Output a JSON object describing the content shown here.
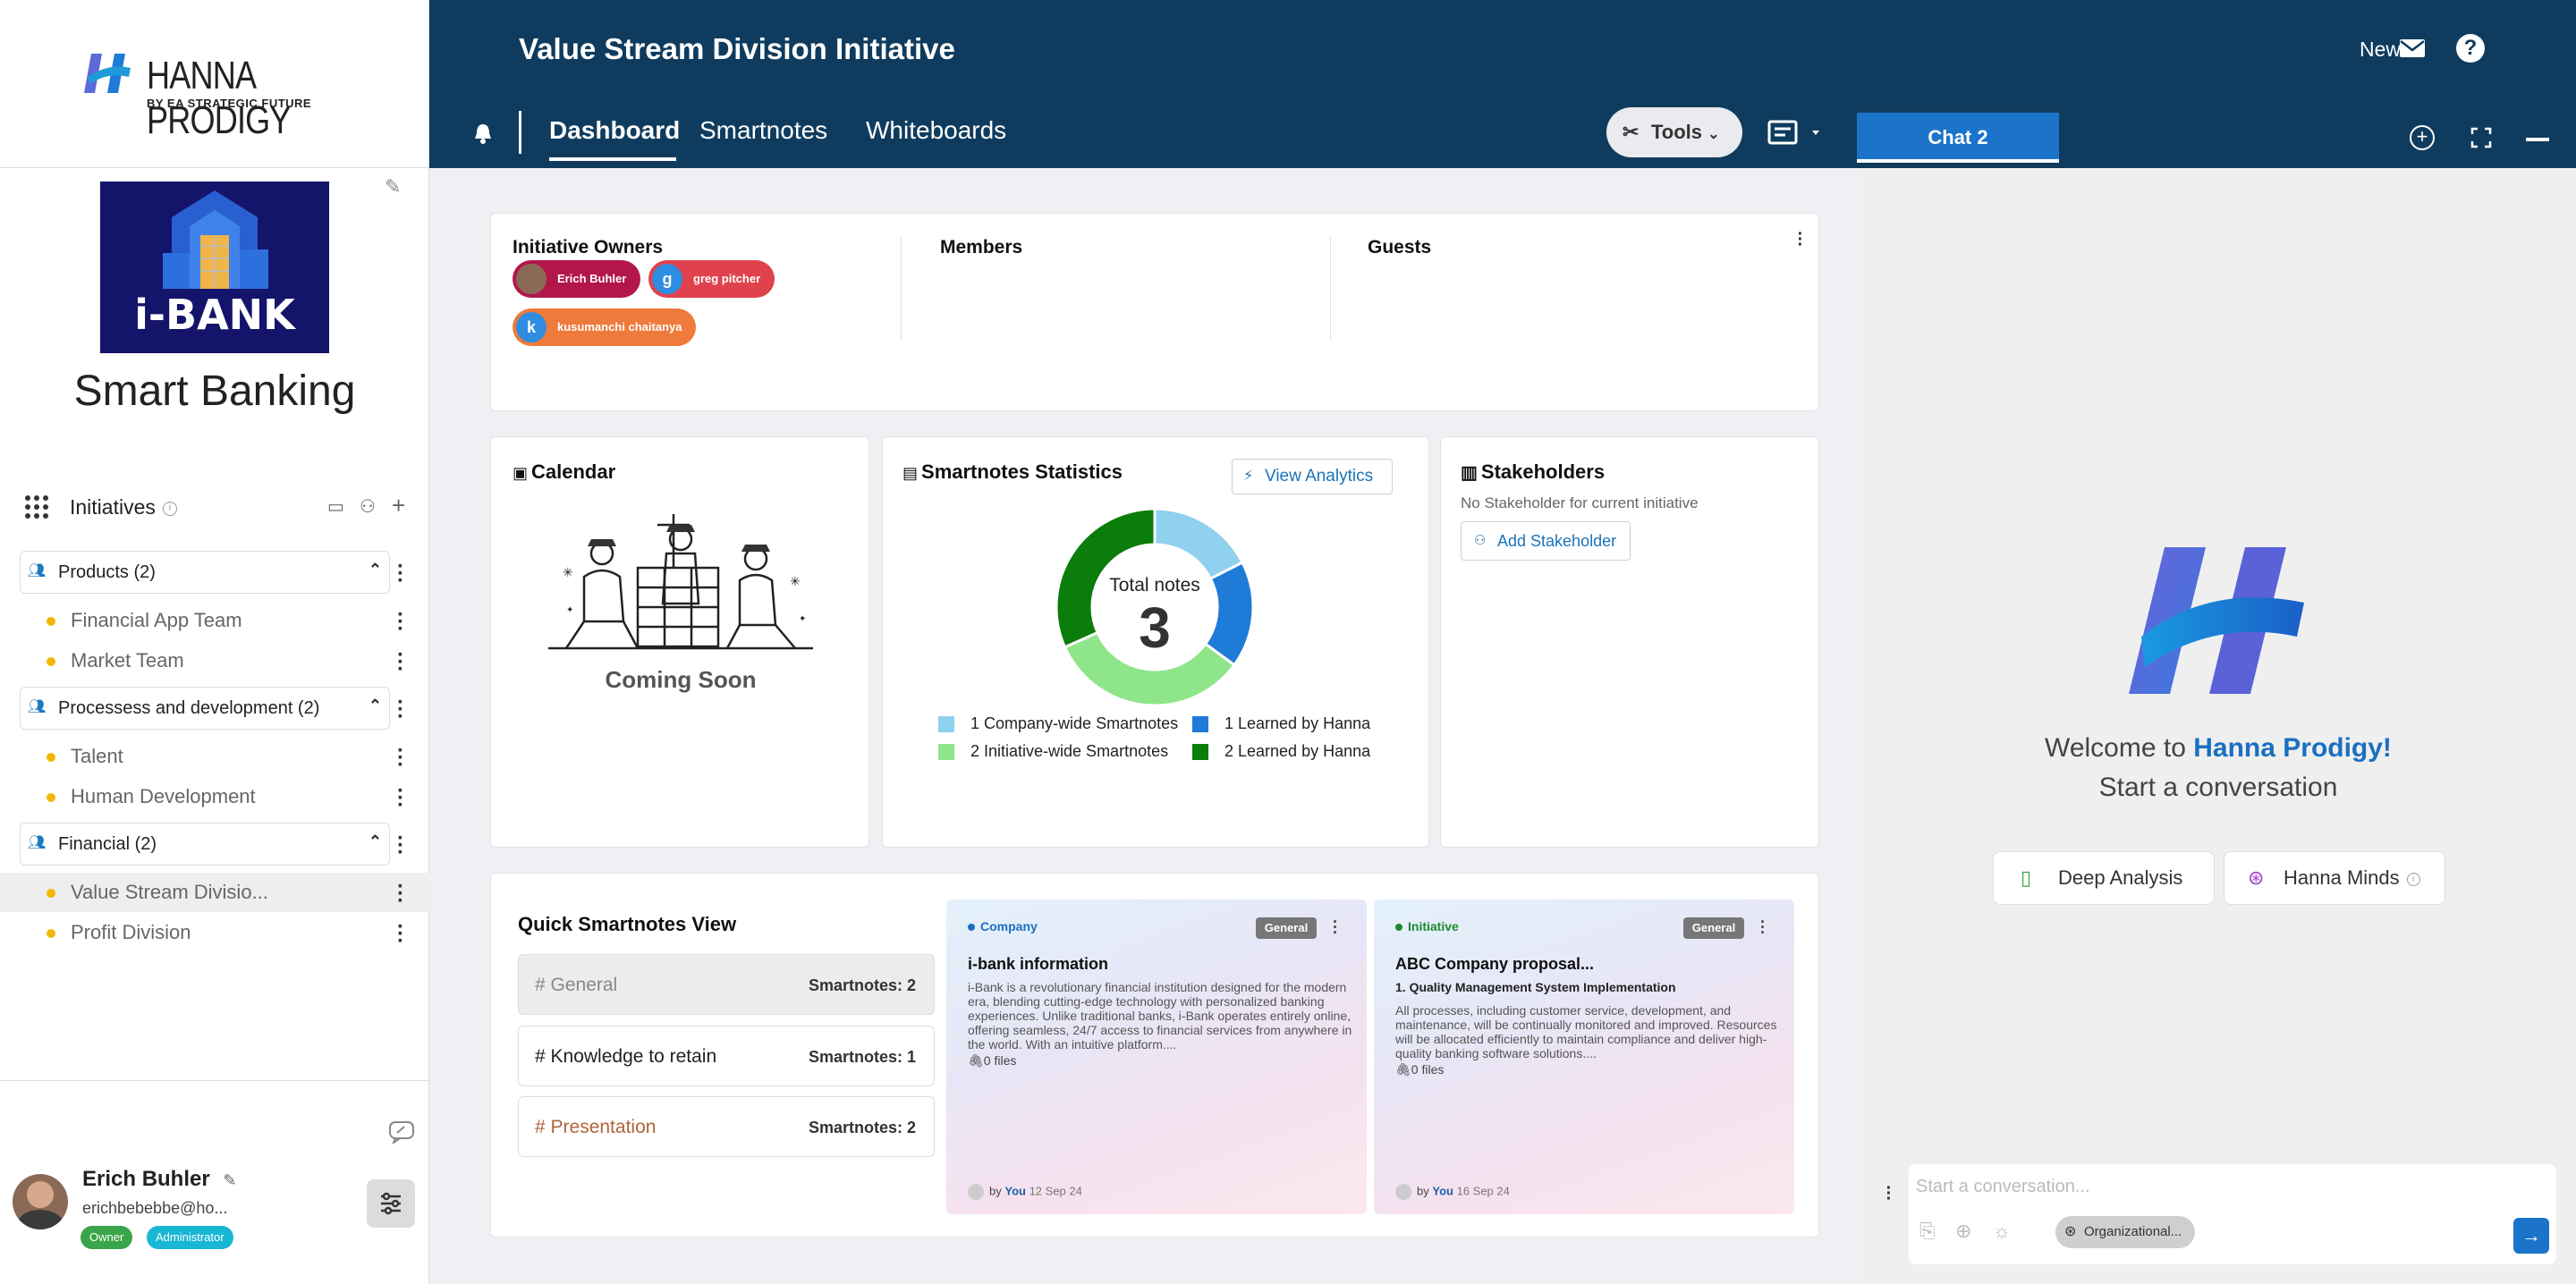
{
  "brand": {
    "name": "HANNA PRODIGY",
    "by": "BY EA STRATEGIC FUTURE"
  },
  "initiative_image": {
    "text": "i-BANK"
  },
  "workspace_title": "Smart Banking",
  "sidebar": {
    "initiatives_label": "Initiatives",
    "groups": [
      {
        "label": "Products (2)",
        "items": [
          "Financial App Team",
          "Market Team"
        ]
      },
      {
        "label": "Processess and development (2)",
        "items": [
          "Talent",
          "Human Development"
        ]
      },
      {
        "label": "Financial (2)",
        "items": [
          "Value Stream Divisio...",
          "Profit Division"
        ]
      }
    ]
  },
  "user": {
    "name": "Erich Buhler",
    "email": "erichbebebbe@ho...",
    "badges": [
      "Owner",
      "Administrator"
    ]
  },
  "header": {
    "title": "Value Stream Division Initiative",
    "news": "News",
    "tabs": [
      "Dashboard",
      "Smartnotes",
      "Whiteboards"
    ],
    "tools": "Tools",
    "chat_tab": "Chat 2"
  },
  "people": {
    "owners_label": "Initiative Owners",
    "owners": [
      {
        "name": "Erich Buhler",
        "initial": "",
        "color": "#b3164b"
      },
      {
        "name": "greg pitcher",
        "initial": "g",
        "color": "#e0424d"
      },
      {
        "name": "kusumanchi chaitanya",
        "initial": "k",
        "color": "#ee7a3c"
      }
    ],
    "members_label": "Members",
    "guests_label": "Guests"
  },
  "calendar": {
    "title": "Calendar",
    "status": "Coming Soon"
  },
  "stats": {
    "title": "Smartnotes Statistics",
    "view_analytics": "View Analytics",
    "center_label": "Total notes",
    "total": "3",
    "legend": [
      "1 Company-wide Smartnotes",
      "1 Learned by Hanna",
      "2 Initiative-wide Smartnotes",
      "2 Learned by Hanna"
    ]
  },
  "chart_data": {
    "type": "pie",
    "title": "Smartnotes Statistics",
    "rings": [
      {
        "name": "outer",
        "values": [
          1,
          2
        ],
        "labels": [
          "Learned by Hanna",
          "Learned by Hanna"
        ],
        "colors": [
          "#1f7bd8",
          "#0a7d0a"
        ]
      },
      {
        "name": "inner",
        "values": [
          1,
          2
        ],
        "labels": [
          "Company-wide Smartnotes",
          "Initiative-wide Smartnotes"
        ],
        "colors": [
          "#8fd1ef",
          "#8fe58a"
        ]
      }
    ],
    "center": {
      "label": "Total notes",
      "value": 3
    }
  },
  "stakeholders": {
    "title": "Stakeholders",
    "empty": "No Stakeholder for current initiative",
    "add": "Add Stakeholder"
  },
  "quick": {
    "title": "Quick Smartnotes View",
    "items": [
      {
        "label": "# General",
        "count": "Smartnotes: 2",
        "color": "#888888"
      },
      {
        "label": "# Knowledge to retain",
        "count": "Smartnotes: 1",
        "color": "#222222"
      },
      {
        "label": "# Presentation",
        "count": "Smartnotes: 2",
        "color": "#b0643a"
      }
    ]
  },
  "notes": [
    {
      "tag": "Company",
      "tag_color": "#1a6fc0",
      "category": "General",
      "title": "i-bank information",
      "subtitle": "",
      "body": "i-Bank is a revolutionary financial institution designed for the modern era, blending cutting-edge technology with personalized banking experiences. Unlike traditional banks, i-Bank operates entirely online, offering seamless, 24/7 access to financial services from anywhere in the world. With an intuitive platform....",
      "files": "0 files",
      "by": "by",
      "author": "You",
      "date": "12 Sep 24"
    },
    {
      "tag": "Initiative",
      "tag_color": "#1b8a2e",
      "category": "General",
      "title": "ABC Company proposal...",
      "subtitle": "1. Quality Management System Implementation",
      "body": "All processes, including customer service, development, and maintenance, will be continually monitored and improved. Resources will be allocated efficiently to maintain compliance and deliver high-quality banking software solutions....",
      "files": "0 files",
      "by": "by",
      "author": "You",
      "date": "16 Sep 24"
    }
  ],
  "chat": {
    "welcome_prefix": "Welcome to",
    "welcome_brand": "Hanna Prodigy!",
    "start": "Start a conversation",
    "buttons": [
      "Deep Analysis",
      "Hanna Minds"
    ],
    "placeholder": "Start a conversation...",
    "scope": "Organizational..."
  }
}
